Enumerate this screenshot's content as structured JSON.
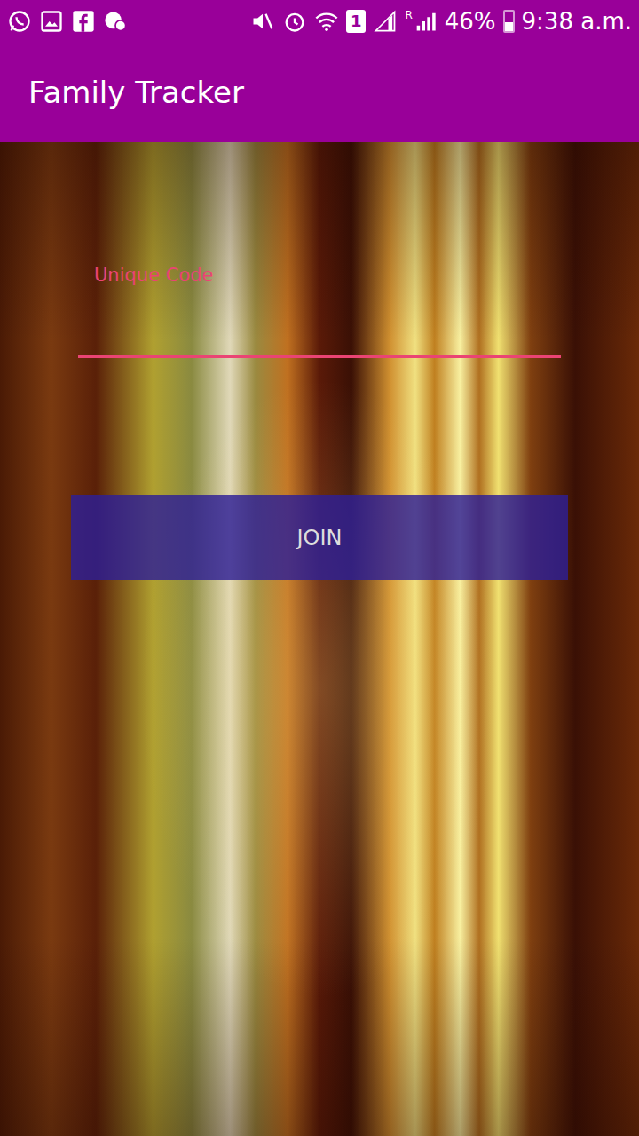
{
  "status_bar": {
    "sim_badge": "1",
    "roaming": "R",
    "battery": {
      "level": 0.46,
      "reading": "46%"
    },
    "time": "9:38 a.m."
  },
  "app_bar": {
    "title": "Family Tracker"
  },
  "form": {
    "field": {
      "label": "Unique Code",
      "value": ""
    },
    "button": "JOIN"
  }
}
